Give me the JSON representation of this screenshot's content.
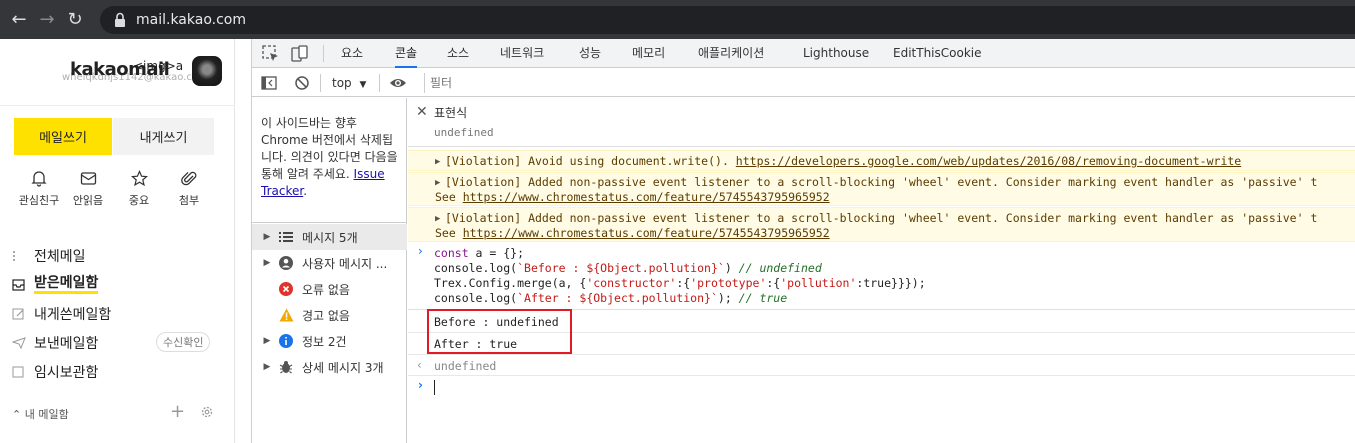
{
  "browser": {
    "url": "mail.kakao.com"
  },
  "mail": {
    "brand": "kakaomail",
    "img_overlay": "<img>a",
    "email_ghost": "whelqkdnjs1142@kakao.com",
    "buttons": {
      "write": "메일쓰기",
      "self": "내게쓰기"
    },
    "quick": [
      {
        "label": "관심친구",
        "icon": "bell-icon"
      },
      {
        "label": "안읽음",
        "icon": "envelope-icon"
      },
      {
        "label": "중요",
        "icon": "star-icon"
      },
      {
        "label": "첨부",
        "icon": "paperclip-icon"
      }
    ],
    "folders": {
      "all": "전체메일",
      "inbox": "받은메일함",
      "to_self": "내게쓴메일함",
      "sent": "보낸메일함",
      "drafts": "임시보관함"
    },
    "receipt_badge": "수신확인",
    "my_mailbox": "내 메일함",
    "accent_color": "#ffe100"
  },
  "devtools": {
    "tabs": [
      "요소",
      "콘솔",
      "소스",
      "네트워크",
      "성능",
      "메모리",
      "애플리케이션",
      "Lighthouse",
      "EditThisCookie"
    ],
    "active_tab": "콘솔",
    "context": "top",
    "filter_placeholder": "필터",
    "sidebar": {
      "note_before_link": "이 사이드바는 향후 Chrome 버전에서 삭제됩니다. 의견이 있다면 다음을 통해 알려 주세요. ",
      "note_link": "Issue Tracker",
      "note_after_link": ".",
      "items": [
        {
          "label": "메시지 5개",
          "icon": "list-icon"
        },
        {
          "label": "사용자 메시지 ...",
          "icon": "user-icon"
        },
        {
          "label": "오류 없음",
          "icon": "error-icon"
        },
        {
          "label": "경고 없음",
          "icon": "warning-icon"
        },
        {
          "label": "정보 2건",
          "icon": "info-icon"
        },
        {
          "label": "상세 메시지 3개",
          "icon": "bug-icon"
        }
      ]
    },
    "console": {
      "expression_label": "표현식",
      "expression_value": "undefined",
      "warnings": [
        {
          "line1": "[Violation] Avoid using document.write(). ",
          "link1": "https://developers.google.com/web/updates/2016/08/removing-document-write",
          "line2_prefix": "",
          "link2": ""
        },
        {
          "line1": "[Violation] Added non-passive event listener to a scroll-blocking 'wheel' event. Consider marking event handler as 'passive' t",
          "link1": "",
          "line2_prefix": "See ",
          "link2": "https://www.chromestatus.com/feature/5745543795965952"
        },
        {
          "line1": "[Violation] Added non-passive event listener to a scroll-blocking 'wheel' event. Consider marking event handler as 'passive' t",
          "link1": "",
          "line2_prefix": "See ",
          "link2": "https://www.chromestatus.com/feature/5745543795965952"
        }
      ],
      "input_code": {
        "l1_kw": "const",
        "l1_rest": " a = {};",
        "l2_a": "console.log(",
        "l2_str": "`Before : ${Object.pollution}`",
        "l2_b": ") ",
        "l2_cm": "// undefined",
        "l3_a": "Trex.Config.merge(a, {",
        "l3_s1": "'constructor'",
        "l3_b": ":{",
        "l3_s2": "'prototype'",
        "l3_c": ":{",
        "l3_s3": "'pollution'",
        "l3_d": ":true}}});",
        "l4_a": "console.log(",
        "l4_str": "`After : ${Object.pollution}`",
        "l4_b": "); ",
        "l4_cm": "// true"
      },
      "logs": [
        "Before : undefined",
        "After : true"
      ],
      "return_value": "undefined",
      "highlight_color": "#e01b24"
    }
  }
}
